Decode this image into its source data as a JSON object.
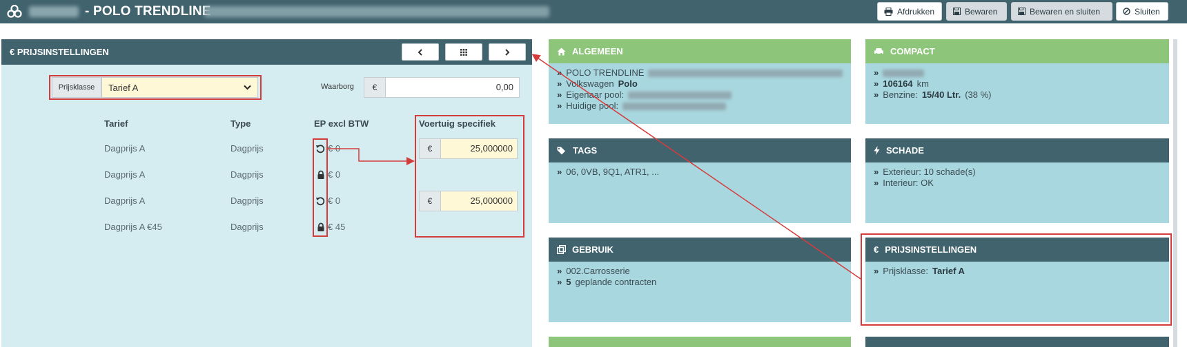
{
  "topbar": {
    "title": "- POLO TRENDLINE",
    "buttons": {
      "print": "Afdrukken",
      "save": "Bewaren",
      "save_close": "Bewaren en sluiten",
      "close": "Sluiten"
    }
  },
  "price_panel": {
    "title": "€ PRIJSINSTELLINGEN",
    "prijsklasse_label": "Prijsklasse",
    "prijsklasse_value": "Tarief A",
    "waarborg_label": "Waarborg",
    "currency": "€",
    "waarborg_value": "0,00",
    "columns": [
      "Tarief",
      "Type",
      "EP excl BTW",
      "Voertuig specifiek"
    ],
    "rows": [
      {
        "tarief": "Dagprijs A",
        "type": "Dagprijs",
        "icon": "reset-icon",
        "ep": "€ 0",
        "vehicle": "25,000000"
      },
      {
        "tarief": "Dagprijs A",
        "type": "Dagprijs",
        "icon": "lock-icon",
        "ep": "€ 0",
        "vehicle": ""
      },
      {
        "tarief": "Dagprijs A",
        "type": "Dagprijs",
        "icon": "reset-icon",
        "ep": "€ 0",
        "vehicle": "25,000000"
      },
      {
        "tarief": "Dagprijs A €45",
        "type": "Dagprijs",
        "icon": "lock-icon",
        "ep": "€ 45",
        "vehicle": ""
      }
    ]
  },
  "cards": {
    "algemeen": {
      "title": "ALGEMEEN",
      "line1": "POLO TRENDLINE",
      "line2_a": "Volkswagen",
      "line2_b": "Polo",
      "line3": "Eigenaar pool:",
      "line4": "Huidige pool:"
    },
    "compact": {
      "title": "COMPACT",
      "km_value": "106164",
      "km_unit": "km",
      "fuel_label": "Benzine:",
      "fuel_value": "15/40 Ltr.",
      "fuel_pct": "(38 %)"
    },
    "tags": {
      "title": "TAGS",
      "line1": "06, 0VB, 9Q1, ATR1, ..."
    },
    "schade": {
      "title": "SCHADE",
      "line1": "Exterieur: 10 schade(s)",
      "line2": "Interieur: OK"
    },
    "gebruik": {
      "title": "GEBRUIK",
      "line1": "002.Carrosserie",
      "line2_a": "5",
      "line2_b": "geplande contracten"
    },
    "prijs": {
      "title": "PRIJSINSTELLINGEN",
      "label": "Prijsklasse:",
      "value": "Tarief A"
    }
  },
  "colors": {
    "header_dark": "#41636e",
    "header_green": "#8dc57a",
    "card_body": "#a9d7df",
    "panel_body": "#d5ecf0",
    "annotation_red": "#d43c3c",
    "input_yellow": "#fff8d6"
  }
}
